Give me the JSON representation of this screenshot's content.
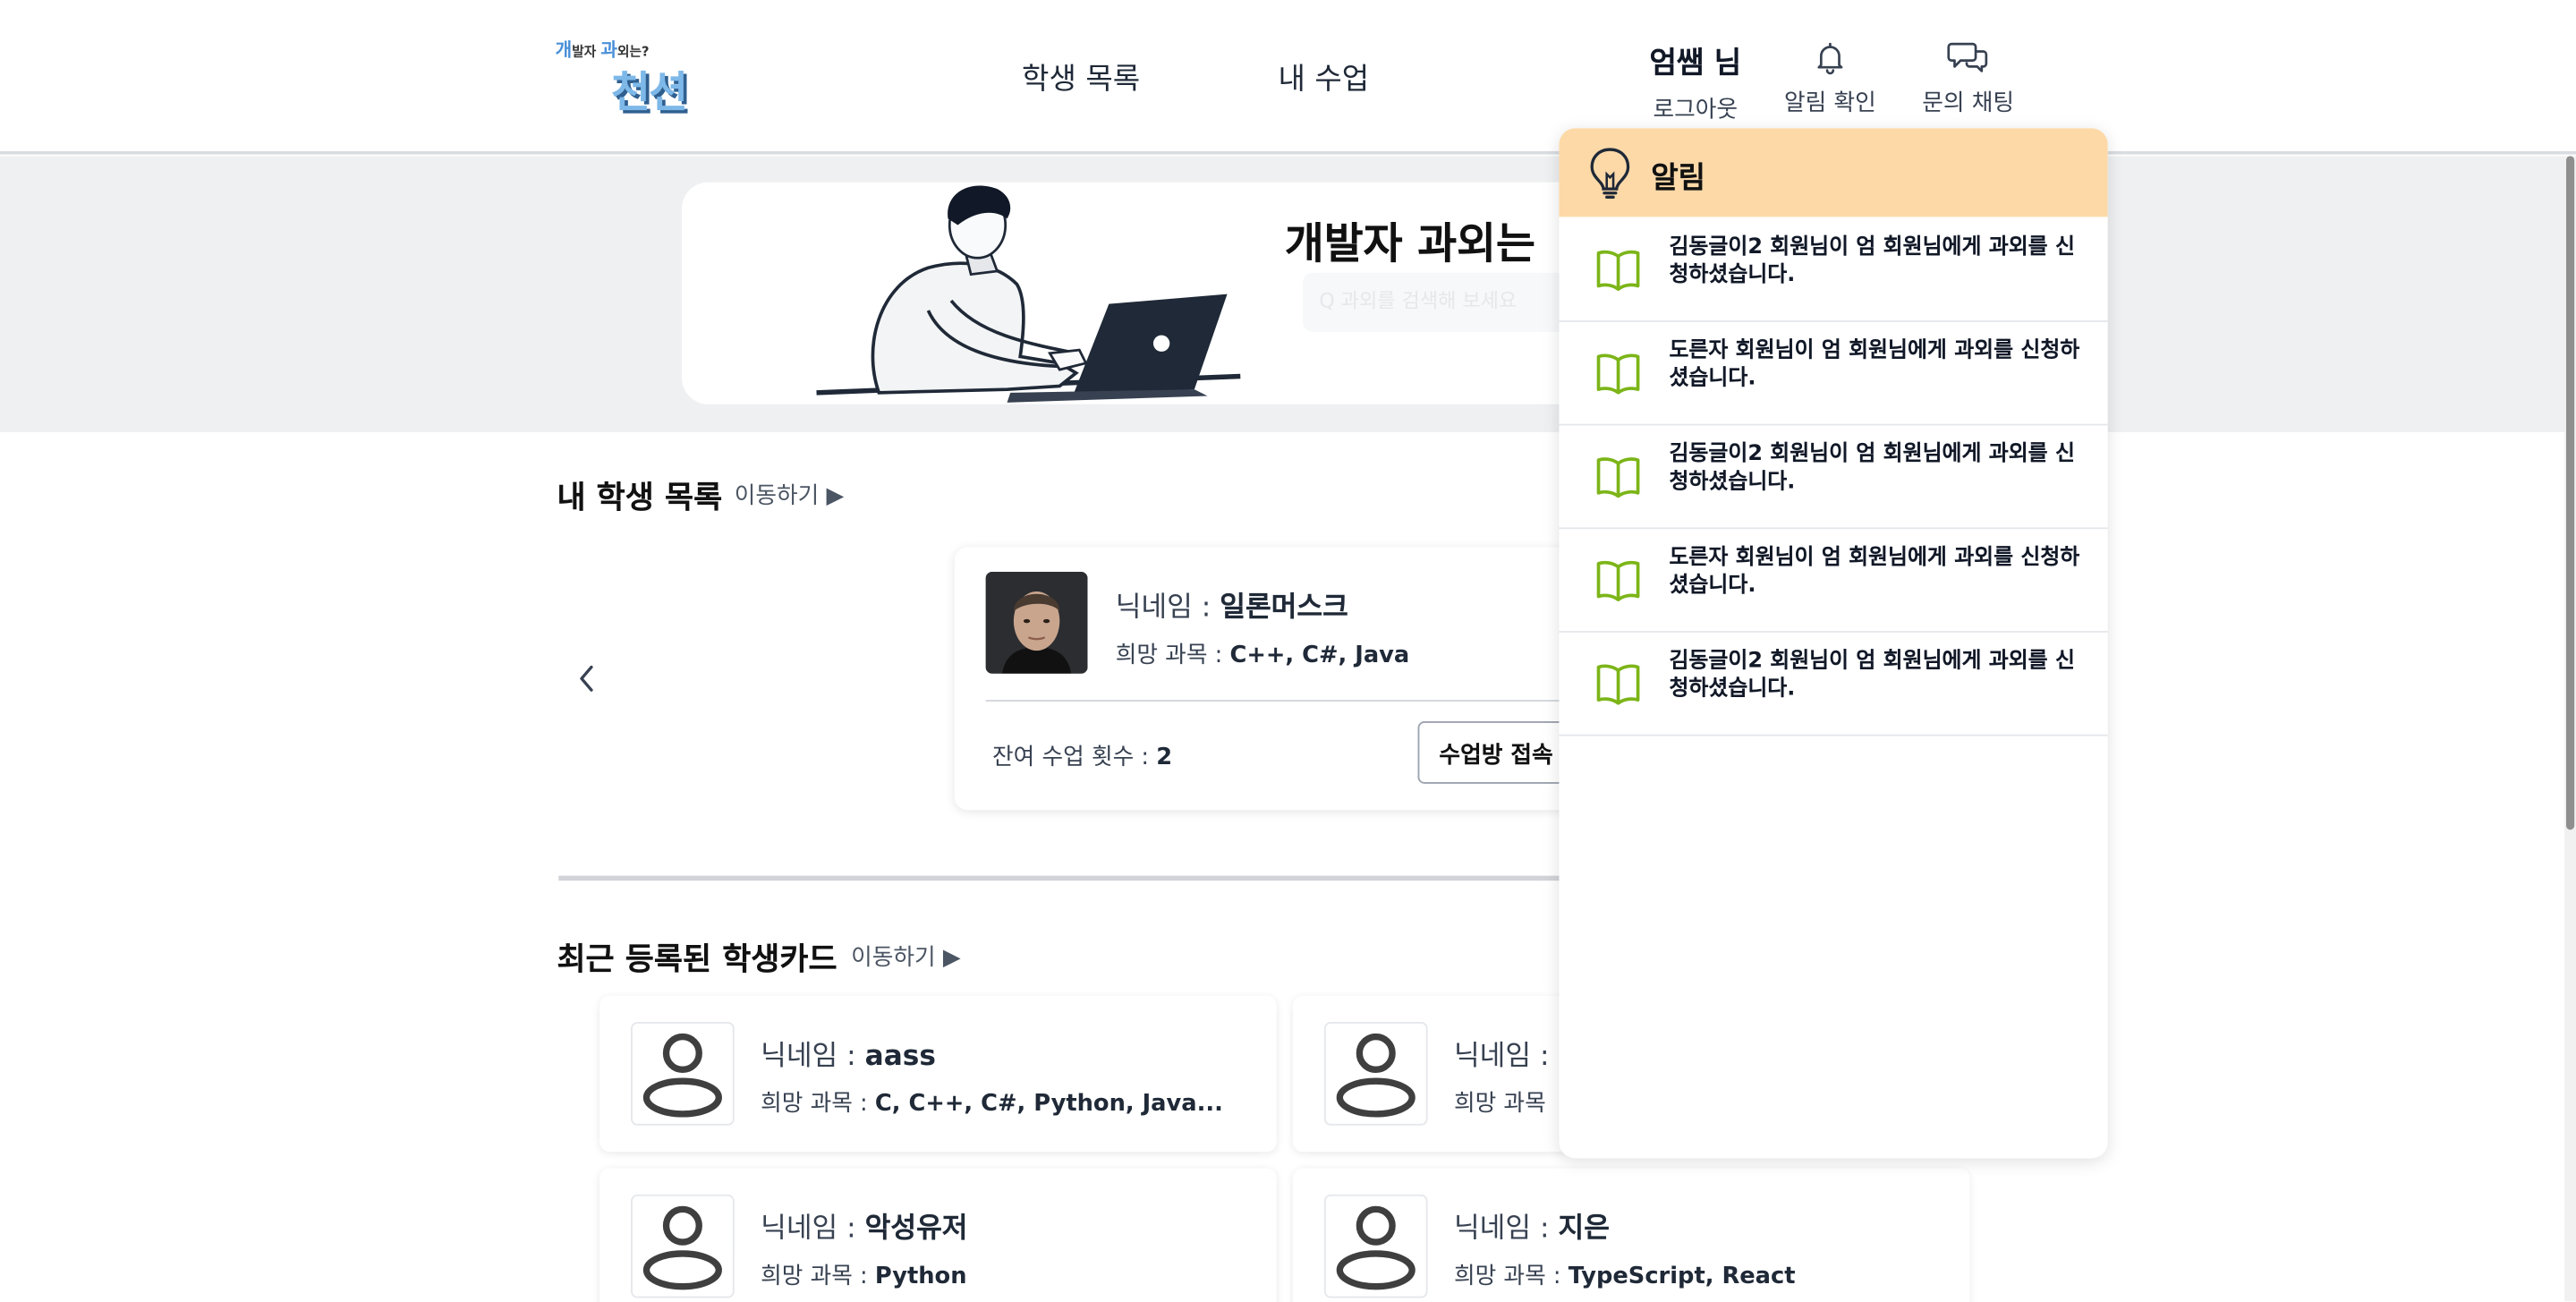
{
  "header": {
    "logo_small_a": "개",
    "logo_small_b": "발자 ",
    "logo_small_c": "과",
    "logo_small_d": "외는?",
    "logo_big": "천션",
    "nav": [
      "학생 목록",
      "내 수업"
    ],
    "user_name": "엄쌤 님",
    "logout": "로그아웃",
    "noti_label": "알림 확인",
    "chat_label": "문의 채팅"
  },
  "banner": {
    "title": "개발자 과외는",
    "subtitle": "Q 과외를 검색해 보세요"
  },
  "my_students": {
    "title": "내 학생 목록",
    "link": "이동하기 ▶",
    "card": {
      "nick_label": "닉네임 : ",
      "nick": "일론머스크",
      "subj_label": "희망 과목 : ",
      "subjects": "C++, C#, Java",
      "remain_label": "잔여 수업 횟수 : ",
      "remain": "2",
      "enter_button": "수업방 접속"
    }
  },
  "recent": {
    "title": "최근 등록된 학생카드",
    "link": "이동하기 ▶",
    "cards": [
      {
        "nick_label": "닉네임 : ",
        "nick": "aass",
        "subj_label": "희망 과목 : ",
        "subjects": "C, C++, C#, Python, Java..."
      },
      {
        "nick_label": "닉네임 : ",
        "nick": "-",
        "subj_label": "희망 과목",
        "subjects": ""
      },
      {
        "nick_label": "닉네임 : ",
        "nick": "악성유저",
        "subj_label": "희망 과목 : ",
        "subjects": "Python"
      },
      {
        "nick_label": "닉네임 : ",
        "nick": "지은",
        "subj_label": "희망 과목 : ",
        "subjects": "TypeScript, React"
      }
    ]
  },
  "notifications": {
    "title": "알림",
    "items": [
      "김동글이2 회원님이 엄 회원님에게 과외를 신청하셨습니다.",
      "도른자 회원님이 엄 회원님에게 과외를 신청하셨습니다.",
      "김동글이2 회원님이 엄 회원님에게 과외를 신청하셨습니다.",
      "도른자 회원님이 엄 회원님에게 과외를 신청하셨습니다.",
      "김동글이2 회원님이 엄 회원님에게 과외를 신청하셨습니다."
    ]
  },
  "colors": {
    "noti_header": "#fdd9a8",
    "book_icon": "#7cb518",
    "banner_band": "#eff0f2"
  }
}
